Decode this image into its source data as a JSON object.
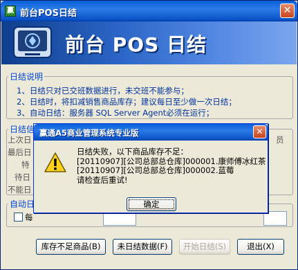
{
  "window": {
    "icon_text": "赢",
    "title": "前台POS日结",
    "banner_title": "前台 POS 日结"
  },
  "instructions": {
    "legend": "日结说明",
    "lines": [
      "1、日结只对已交班数据进行，未交班不能参与；",
      "2、日结时，将扣减销售商品库存；建议每日至少做一次日结；",
      "3、自动日结：服务器 SQL Server Agent必须在运行；"
    ]
  },
  "info_group": {
    "legend": "日结信",
    "labels": [
      "上次日",
      "最后日",
      "特",
      "待日",
      "不能日"
    ],
    "right_fragment": "员"
  },
  "auto_group": {
    "legend": "自动日",
    "checkbox_label": "每"
  },
  "buttons": {
    "stock_short": "库存不足商品(B)",
    "unsettled": "未日结数据(F)",
    "start": "开始日结(S)",
    "exit": "退出(X)"
  },
  "dialog": {
    "title": "赢通A5商业管理系统专业版",
    "message": [
      "日结失败，以下商品库存不足：",
      "[20110907][公司总部总仓库]000001.康师傅冰红茶",
      "[20110907][公司总部总仓库]000002.蓝莓",
      "请检查后重试!"
    ],
    "ok": "确定"
  }
}
